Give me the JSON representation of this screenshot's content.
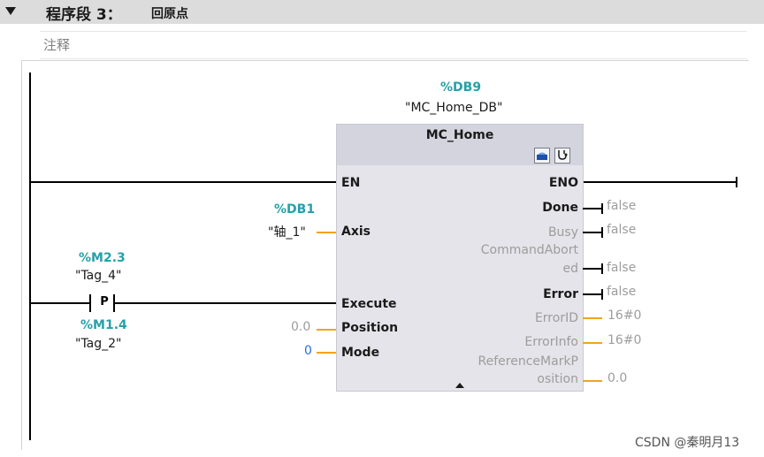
{
  "network": {
    "title": "程序段 3：",
    "name": "回原点",
    "comment_placeholder": "注释"
  },
  "block": {
    "instance_addr": "%DB9",
    "instance_name": "\"MC_Home_DB\"",
    "type": "MC_Home",
    "icons": [
      "db-icon",
      "stethoscope-icon"
    ]
  },
  "contact": {
    "type": "P",
    "addr": "%M2.3",
    "tag": "\"Tag_4\"",
    "edge_addr": "%M1.4",
    "edge_tag": "\"Tag_2\""
  },
  "inputs": {
    "en": "EN",
    "axis": {
      "pin": "Axis",
      "addr": "%DB1",
      "tag": "\"轴_1\""
    },
    "execute": {
      "pin": "Execute"
    },
    "position": {
      "pin": "Position",
      "value": "0.0"
    },
    "mode": {
      "pin": "Mode",
      "value": "0"
    }
  },
  "outputs": {
    "eno": "ENO",
    "done": {
      "pin": "Done",
      "value": "false"
    },
    "busy": {
      "pin": "Busy",
      "value": "false"
    },
    "command_aborted": {
      "pin_line1": "CommandAbort",
      "pin_line2": "ed",
      "value": "false"
    },
    "error": {
      "pin": "Error",
      "value": "false"
    },
    "error_id": {
      "pin": "ErrorID",
      "value": "16#0"
    },
    "error_info": {
      "pin": "ErrorInfo",
      "value": "16#0"
    },
    "reference_mark": {
      "pin_line1": "ReferenceMarkP",
      "pin_line2": "osition",
      "value": "0.0"
    }
  },
  "watermark": "CSDN @秦明月13",
  "colors": {
    "operand": "#26a0a8",
    "constant": "#2b6fd6",
    "wire": "#f5a21b",
    "header": "#dcdcdc"
  }
}
